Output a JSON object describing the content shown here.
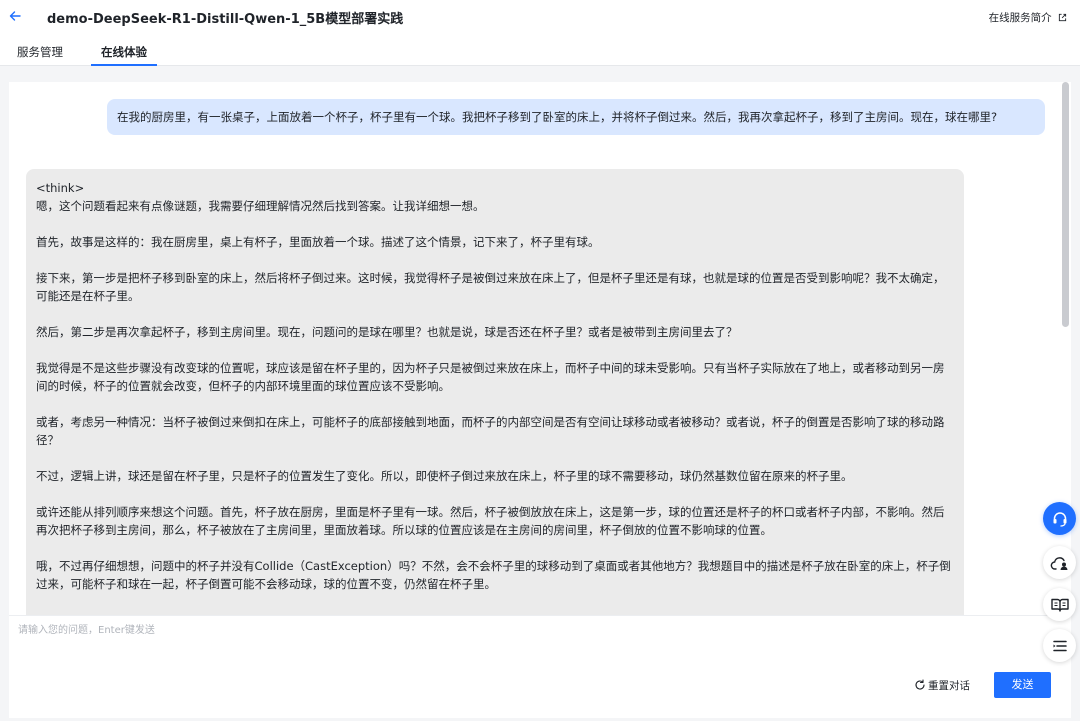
{
  "header": {
    "back_icon": "arrow-left-icon",
    "title": "demo-DeepSeek-R1-Distill-Qwen-1_5B模型部署实践",
    "intro_link": "在线服务简介",
    "intro_link_icon": "external-link-icon"
  },
  "tabs": [
    {
      "label": "服务管理",
      "active": false
    },
    {
      "label": "在线体验",
      "active": true
    }
  ],
  "chat": {
    "user_message": "在我的厨房里，有一张桌子，上面放着一个杯子，杯子里有一个球。我把杯子移到了卧室的床上，并将杯子倒过来。然后，我再次拿起杯子，移到了主房间。现在，球在哪里?",
    "assistant_paragraphs": [
      "<think>",
      "嗯，这个问题看起来有点像谜题，我需要仔细理解情况然后找到答案。让我详细想一想。",
      "首先，故事是这样的：我在厨房里，桌上有杯子，里面放着一个球。描述了这个情景，记下来了，杯子里有球。",
      "接下来，第一步是把杯子移到卧室的床上，然后将杯子倒过来。这时候，我觉得杯子是被倒过来放在床上了，但是杯子里还是有球，也就是球的位置是否受到影响呢？我不太确定，可能还是在杯子里。",
      "然后，第二步是再次拿起杯子，移到主房间里。现在，问题问的是球在哪里？也就是说，球是否还在杯子里？或者是被带到主房间里去了？",
      "我觉得是不是这些步骤没有改变球的位置呢，球应该是留在杯子里的，因为杯子只是被倒过来放在床上，而杯子中间的球未受影响。只有当杯子实际放在了地上，或者移动到另一房间的时候，杯子的位置就会改变，但杯子的内部环境里面的球位置应该不受影响。",
      "或者，考虑另一种情况：当杯子被倒过来倒扣在床上，可能杯子的底部接触到地面，而杯子的内部空间是否有空间让球移动或者被移动？或者说，杯子的倒置是否影响了球的移动路径？",
      "不过，逻辑上讲，球还是留在杯子里，只是杯子的位置发生了变化。所以，即使杯子倒过来放在床上，杯子里的球不需要移动，球仍然基数位留在原来的杯子里。",
      "或许还能从排列顺序来想这个问题。首先，杯子放在厨房，里面是杯子里有一球。然后，杯子被倒放放在床上，这是第一步，球的位置还是杯子的杯口或者杯子内部，不影响。然后再次把杯子移到主房间，那么，杯子被放在了主房间里，里面放着球。所以球的位置应该是在主房间的房间里，杯子倒放的位置不影响球的位置。",
      "哦，不过再仔细想想，问题中的杯子并没有Collide（CastException）吗？不然，会不会杯子里的球移动到了桌面或者其他地方？我想题目中的描述是杯子放在卧室的床上，杯子倒过来，可能杯子和球在一起，杯子倒置可能不会移动球，球的位置不变，仍然留在杯子里。"
    ]
  },
  "input": {
    "placeholder": "请输入您的问题，Enter键发送",
    "value": ""
  },
  "actions": {
    "reset_label": "重置对话",
    "reset_icon": "refresh-icon",
    "send_label": "发送"
  },
  "floating_buttons": [
    {
      "icon": "customer-service-icon"
    },
    {
      "icon": "cloud-user-icon"
    },
    {
      "icon": "book-icon"
    },
    {
      "icon": "list-icon"
    }
  ],
  "colors": {
    "accent": "#1f6fff",
    "user_bubble": "#d9e7ff",
    "assistant_bubble": "#ebebeb"
  }
}
